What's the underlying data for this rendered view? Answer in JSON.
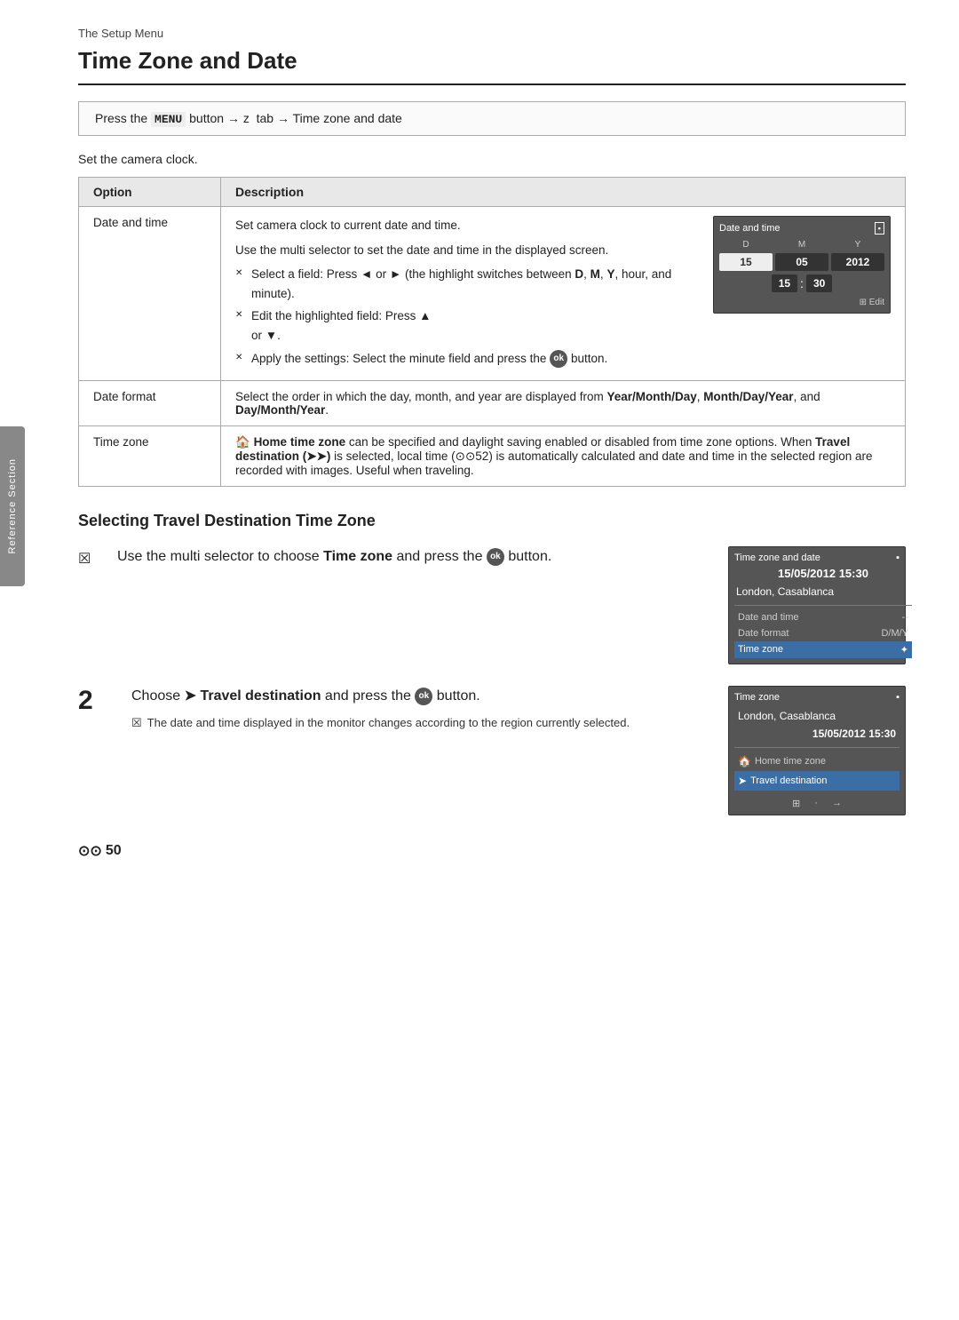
{
  "page": {
    "side_tab_label": "Reference Section",
    "setup_menu_label": "The Setup Menu",
    "title": "Time Zone and Date",
    "instruction": {
      "text": "Press the MENU button → z  tab → Time zone and date",
      "menu_label": "MENU"
    },
    "camera_clock_label": "Set the camera clock.",
    "table": {
      "col1_header": "Option",
      "col2_header": "Description",
      "rows": [
        {
          "option": "Date and time",
          "description_lines": [
            "Set camera clock to current date and time.",
            "Use the multi selector to set the date and time in the displayed screen.",
            "✕ Select a field: Press ◄ or ► (the highlight switches between D, M, Y, hour, and minute).",
            "✕ Edit the highlighted field: Press ▲ or ▼.",
            "✕ Apply the settings: Select the minute field and press the ⊛ button."
          ],
          "screen": {
            "title": "Date and time",
            "d_label": "D",
            "m_label": "M",
            "y_label": "Y",
            "day_value": "15",
            "month_value": "05",
            "year_value": "2012",
            "hour_value": "15",
            "minute_value": "30",
            "edit_label": "⊞ Edit"
          }
        },
        {
          "option": "Date format",
          "description": "Select the order in which the day, month, and year are displayed from Year/Month/Day, Month/Day/Year, and Day/Month/Year."
        },
        {
          "option": "Time zone",
          "description": "🏠 Home time zone can be specified and daylight saving enabled or disabled from time zone options. When Travel destination (➤➤) is selected, local time (⊙⊙52) is automatically calculated and date and time in the selected region are recorded with images. Useful when traveling."
        }
      ]
    },
    "section2": {
      "heading": "Selecting Travel Destination Time Zone",
      "step1": {
        "checkbox_symbol": "☒",
        "main_text_1": "Use the multi selector to choose ",
        "main_text_bold": "Time zone",
        "main_text_2": " and press the ",
        "ok_symbol": "⊛",
        "main_text_3": " button.",
        "screen": {
          "title": "Time zone and date",
          "battery_icon": "▪",
          "date": "15/05/2012 15:30",
          "location": "London, Casablanca",
          "rows": [
            {
              "label": "Date and time",
              "value": "--",
              "selected": false
            },
            {
              "label": "Date format",
              "value": "D/M/Y",
              "selected": false
            },
            {
              "label": "Time zone",
              "value": "✦",
              "selected": true
            }
          ]
        }
      },
      "step2": {
        "step_number": "2",
        "main_text_1": "Choose ",
        "main_text_arrow": "➤",
        "main_text_bold": " Travel destination",
        "main_text_2": " and press the ",
        "ok_symbol": "⊛",
        "main_text_3": " button.",
        "sub_checkbox": "☒",
        "sub_text": "The date and time displayed in the monitor changes according to the region currently selected.",
        "screen": {
          "title": "Time zone",
          "battery_icon": "▪",
          "location": "London, Casablanca",
          "datetime": "15/05/2012 15:30",
          "rows": [
            {
              "label": "🏠 Home time zone",
              "icon": "home",
              "selected": false
            },
            {
              "label": "➤ Travel destination",
              "icon": "arrow",
              "selected": true
            }
          ],
          "footer_left": "⊞",
          "footer_right": "→"
        }
      }
    },
    "footer": {
      "symbol": "⊙⊙",
      "number": "50"
    }
  }
}
